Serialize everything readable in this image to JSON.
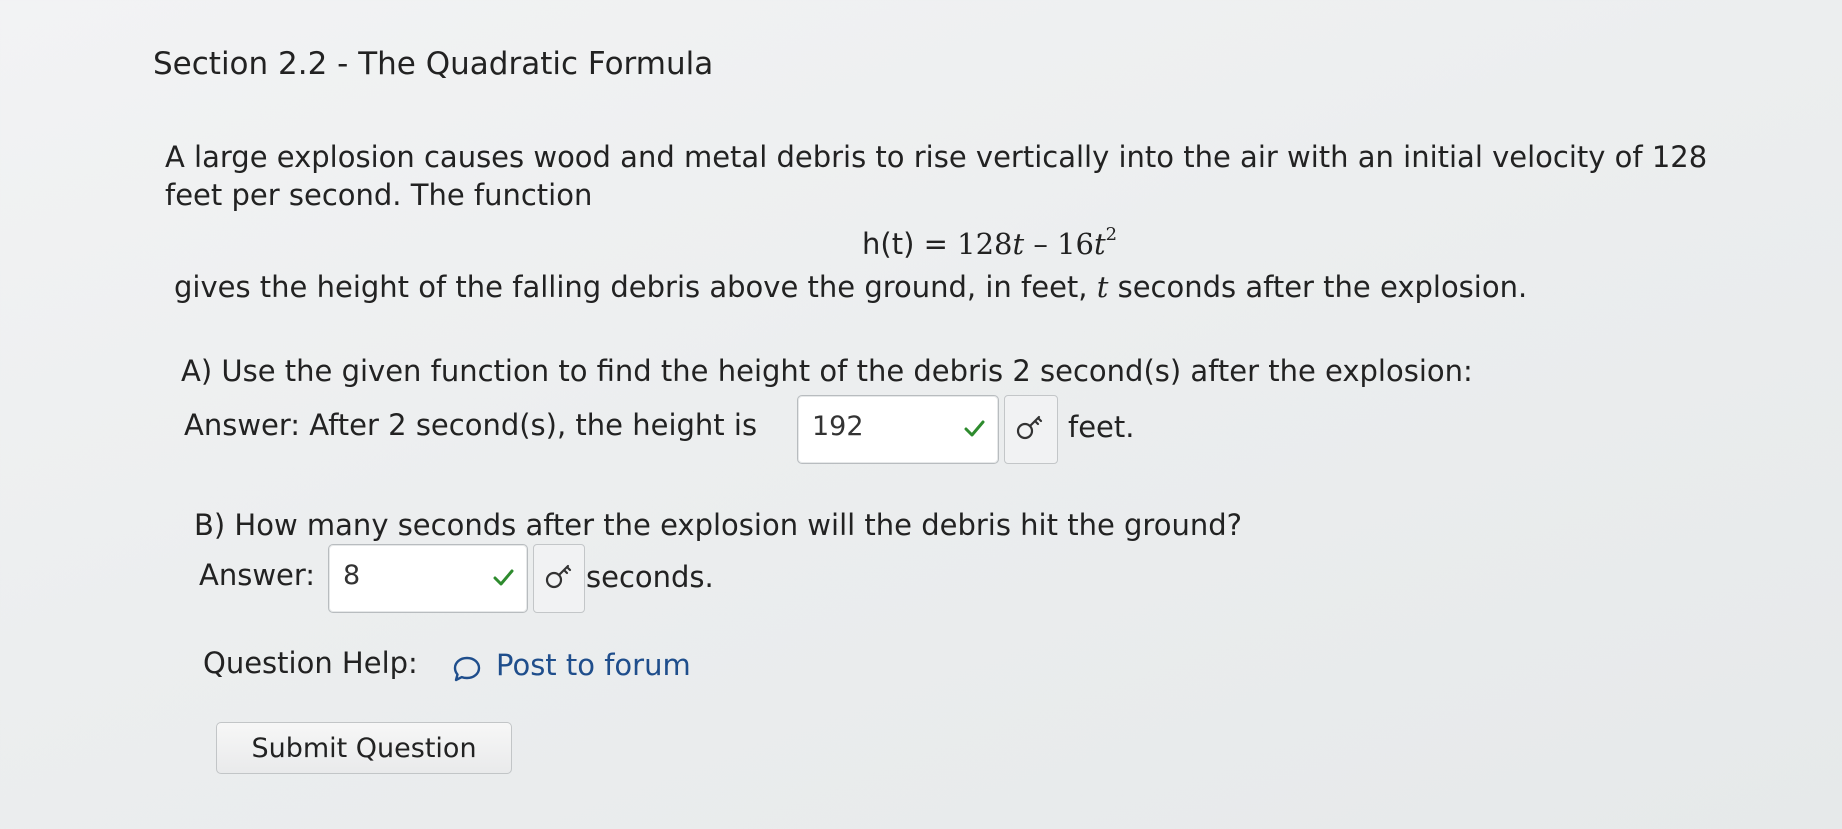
{
  "section": {
    "title": "Section 2.2 - The Quadratic Formula"
  },
  "problem": {
    "line1": "A large explosion causes wood and metal debris to rise vertically into the air with an initial velocity of 128",
    "line2": "feet per second. The function",
    "equation_lhs": "h(t) = ",
    "equation_coef1": "128",
    "equation_var1": "t",
    "equation_minus": " – ",
    "equation_coef2": "16",
    "equation_var2": "t",
    "equation_exponent": "2",
    "gives_before": "gives the height of the falling debris above the ground, in feet, ",
    "gives_var": "t",
    "gives_after": " seconds after the explosion."
  },
  "part_a": {
    "question": "A) Use the given function to find the height of the debris 2 second(s) after the explosion:",
    "answer_label": "Answer: After 2 second(s), the height is",
    "answer_value": "192",
    "status": "correct",
    "unit": "feet."
  },
  "part_b": {
    "question": "B) How many seconds after the explosion will the debris hit the ground?",
    "answer_label": "Answer:",
    "answer_value": "8",
    "status": "correct",
    "unit": "seconds."
  },
  "help": {
    "label": "Question Help:",
    "forum_link": "Post to forum"
  },
  "submit": {
    "label": "Submit Question"
  },
  "colors": {
    "check_green": "#2e8b2e",
    "link_blue": "#1f4e8c"
  },
  "icons": {
    "check": "check-icon",
    "key": "key-icon",
    "forum": "speech-bubble-icon"
  }
}
